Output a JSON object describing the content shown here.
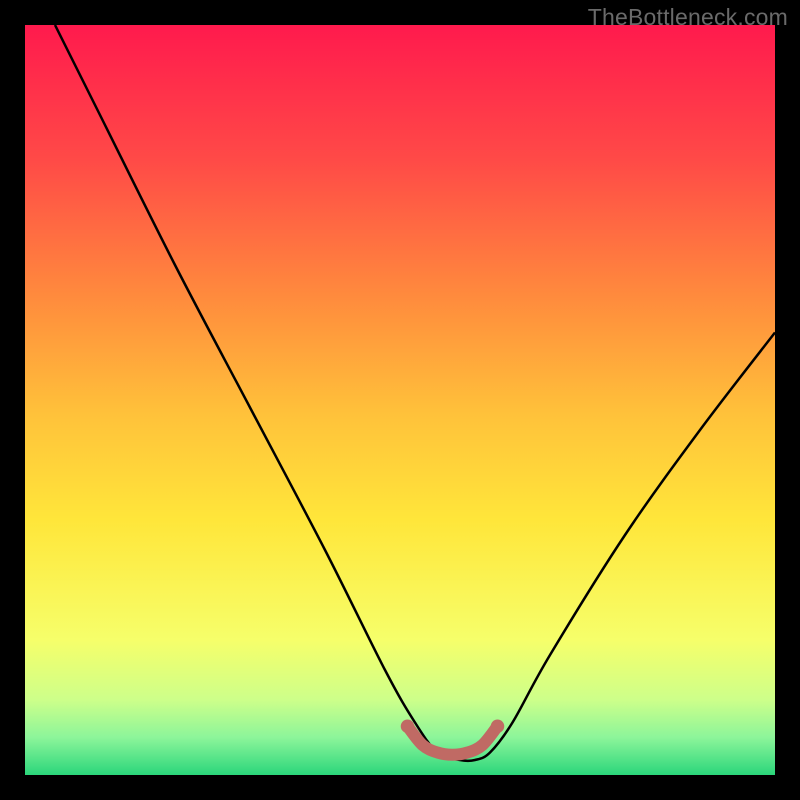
{
  "watermark": "TheBottleneck.com",
  "colors": {
    "frame": "#000000",
    "curve": "#000000",
    "highlight": "#c06a64",
    "watermark_text": "#6a6a6a"
  },
  "chart_data": {
    "type": "line",
    "title": "",
    "xlabel": "",
    "ylabel": "",
    "xlim": [
      0,
      100
    ],
    "ylim": [
      0,
      100
    ],
    "background_gradient_stops": [
      {
        "pos": 0,
        "color": "#ff1a4d"
      },
      {
        "pos": 18,
        "color": "#ff4a47"
      },
      {
        "pos": 36,
        "color": "#ff8a3d"
      },
      {
        "pos": 52,
        "color": "#ffc23a"
      },
      {
        "pos": 66,
        "color": "#ffe63a"
      },
      {
        "pos": 82,
        "color": "#f6ff6a"
      },
      {
        "pos": 90,
        "color": "#cdff8a"
      },
      {
        "pos": 95,
        "color": "#8cf59a"
      },
      {
        "pos": 100,
        "color": "#2bd67b"
      }
    ],
    "series": [
      {
        "name": "bottleneck-curve",
        "x": [
          4,
          10,
          20,
          30,
          40,
          48,
          52,
          55,
          58,
          60,
          62,
          65,
          70,
          80,
          90,
          100
        ],
        "y": [
          100,
          88,
          68,
          49,
          30,
          14,
          7,
          3,
          2,
          2,
          3,
          7,
          16,
          32,
          46,
          59
        ]
      }
    ],
    "highlight_segment": {
      "note": "thick salmon spline near trough with endpoint dots",
      "x": [
        51,
        53,
        55,
        57,
        59,
        61,
        63
      ],
      "y": [
        6.5,
        4.0,
        3.0,
        2.7,
        3.0,
        4.0,
        6.5
      ],
      "dot_left": {
        "x": 51,
        "y": 6.5
      },
      "dot_right": {
        "x": 63,
        "y": 6.5
      }
    }
  }
}
